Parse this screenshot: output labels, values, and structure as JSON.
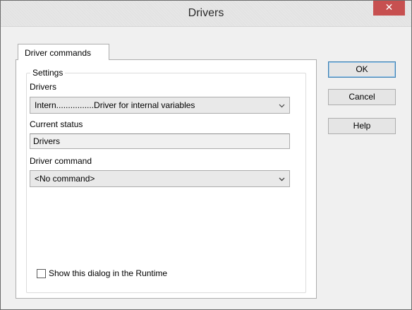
{
  "window": {
    "title": "Drivers",
    "close_glyph": "✕"
  },
  "tabs": [
    {
      "label": "Driver commands",
      "active": true
    }
  ],
  "settings": {
    "group_title": "Settings",
    "drivers_label": "Drivers",
    "drivers_value": "Intern................Driver for internal variables",
    "status_label": "Current status",
    "status_value": "Drivers",
    "command_label": "Driver command",
    "command_value": "<No command>",
    "show_in_runtime_label": "Show this dialog in the Runtime",
    "show_in_runtime_checked": false
  },
  "buttons": {
    "ok": "OK",
    "cancel": "Cancel",
    "help": "Help"
  },
  "colors": {
    "close_button": "#c75050",
    "default_button_border": "#3c7fb1"
  }
}
